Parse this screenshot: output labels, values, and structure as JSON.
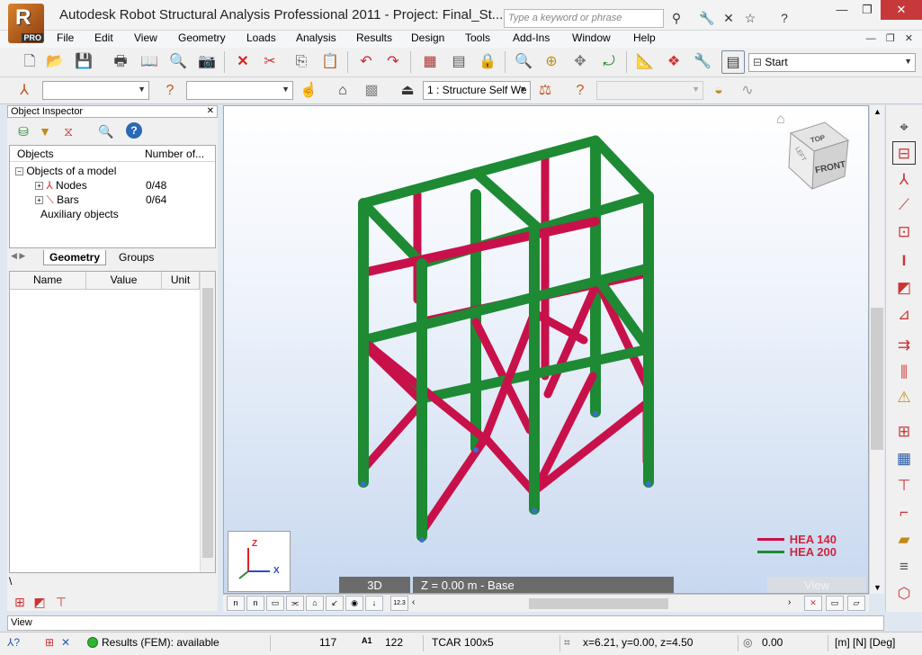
{
  "window": {
    "title": "Autodesk Robot Structural Analysis Professional 2011 - Project: Final_St...",
    "logo_text": "R",
    "logo_badge": "PRO",
    "search_placeholder": "Type a keyword or phrase"
  },
  "menu": [
    "File",
    "Edit",
    "View",
    "Geometry",
    "Loads",
    "Analysis",
    "Results",
    "Design",
    "Tools",
    "Add-Ins",
    "Window",
    "Help"
  ],
  "toolbar": {
    "layout_combo": "Start",
    "case_combo": "1 : Structure Self We",
    "combo_a": "",
    "combo_b": "",
    "combo_c": ""
  },
  "object_inspector": {
    "title": "Object Inspector",
    "columns": [
      "Objects",
      "Number of..."
    ],
    "tree": [
      {
        "label": "Objects of a model",
        "value": ""
      },
      {
        "label": "Nodes",
        "value": "0/48"
      },
      {
        "label": "Bars",
        "value": "0/64"
      },
      {
        "label": "Auxiliary objects",
        "value": ""
      }
    ],
    "tabs": [
      "Geometry",
      "Groups"
    ],
    "prop_columns": [
      "Name",
      "Value",
      "Unit"
    ],
    "bottom_tab": "\\"
  },
  "viewport": {
    "view_3d": "3D",
    "plane": "Z = 0.00 m - Base",
    "view_label": "View",
    "cube_top": "TOP",
    "cube_front": "FRONT",
    "cube_left": "LEFT",
    "axis_z": "Z",
    "axis_x": "X",
    "legend": [
      {
        "name": "HEA 140",
        "color": "#c8114a"
      },
      {
        "name": "HEA 200",
        "color": "#1e7a2c"
      }
    ]
  },
  "view_input": "View",
  "statusbar": {
    "results": "Results (FEM): available",
    "nodes": "117",
    "bars": "122",
    "section": "TCAR 100x5",
    "coords": "x=6.21, y=0.00, z=4.50",
    "angle": "0.00",
    "units": "[m] [N] [Deg]"
  },
  "colors": {
    "member_green": "#1e8a34",
    "member_red": "#c8114a"
  }
}
